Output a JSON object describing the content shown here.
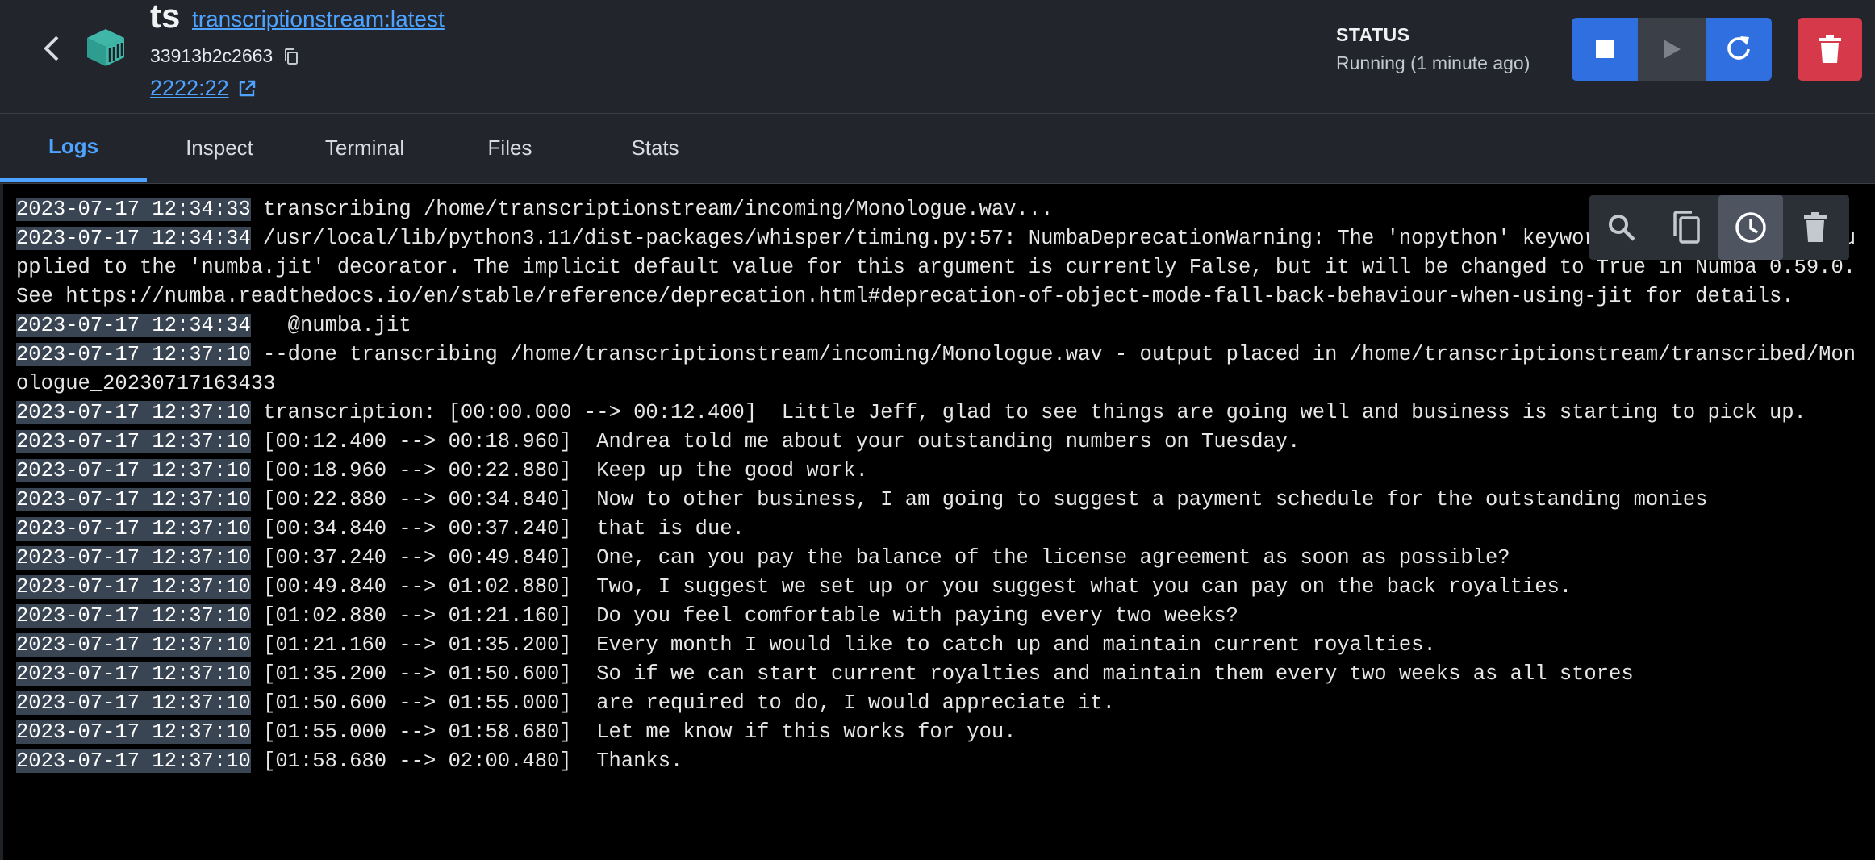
{
  "header": {
    "container_name": "ts",
    "image_link": "transcriptionstream:latest",
    "container_id": "33913b2c2663",
    "port_link": "2222:22",
    "status_label": "STATUS",
    "status_value": "Running (1 minute ago)"
  },
  "tabs": [
    {
      "label": "Logs",
      "active": true
    },
    {
      "label": "Inspect"
    },
    {
      "label": "Terminal"
    },
    {
      "label": "Files"
    },
    {
      "label": "Stats"
    }
  ],
  "colors": {
    "accent": "#4da3ff",
    "primary_button": "#2f6fe0",
    "delete_button": "#d63a4a",
    "timestamp_bg": "#3a4553"
  },
  "log_lines": [
    {
      "ts": "2023-07-17 12:34:33",
      "text": " transcribing /home/transcriptionstream/incoming/Monologue.wav..."
    },
    {
      "ts": "2023-07-17 12:34:34",
      "text": " /usr/local/lib/python3.11/dist-packages/whisper/timing.py:57: NumbaDeprecationWarning: The 'nopython' keyword argument was not supplied to the 'numba.jit' decorator. The implicit default value for this argument is currently False, but it will be changed to True in Numba 0.59.0. See https://numba.readthedocs.io/en/stable/reference/deprecation.html#deprecation-of-object-mode-fall-back-behaviour-when-using-jit for details."
    },
    {
      "ts": "2023-07-17 12:34:34",
      "text": "   @numba.jit"
    },
    {
      "ts": "2023-07-17 12:37:10",
      "text": " --done transcribing /home/transcriptionstream/incoming/Monologue.wav - output placed in /home/transcriptionstream/transcribed/Monologue_20230717163433"
    },
    {
      "ts": "2023-07-17 12:37:10",
      "text": " transcription: [00:00.000 --> 00:12.400]  Little Jeff, glad to see things are going well and business is starting to pick up."
    },
    {
      "ts": "2023-07-17 12:37:10",
      "text": " [00:12.400 --> 00:18.960]  Andrea told me about your outstanding numbers on Tuesday."
    },
    {
      "ts": "2023-07-17 12:37:10",
      "text": " [00:18.960 --> 00:22.880]  Keep up the good work."
    },
    {
      "ts": "2023-07-17 12:37:10",
      "text": " [00:22.880 --> 00:34.840]  Now to other business, I am going to suggest a payment schedule for the outstanding monies"
    },
    {
      "ts": "2023-07-17 12:37:10",
      "text": " [00:34.840 --> 00:37.240]  that is due."
    },
    {
      "ts": "2023-07-17 12:37:10",
      "text": " [00:37.240 --> 00:49.840]  One, can you pay the balance of the license agreement as soon as possible?"
    },
    {
      "ts": "2023-07-17 12:37:10",
      "text": " [00:49.840 --> 01:02.880]  Two, I suggest we set up or you suggest what you can pay on the back royalties."
    },
    {
      "ts": "2023-07-17 12:37:10",
      "text": " [01:02.880 --> 01:21.160]  Do you feel comfortable with paying every two weeks?"
    },
    {
      "ts": "2023-07-17 12:37:10",
      "text": " [01:21.160 --> 01:35.200]  Every month I would like to catch up and maintain current royalties."
    },
    {
      "ts": "2023-07-17 12:37:10",
      "text": " [01:35.200 --> 01:50.600]  So if we can start current royalties and maintain them every two weeks as all stores"
    },
    {
      "ts": "2023-07-17 12:37:10",
      "text": " [01:50.600 --> 01:55.000]  are required to do, I would appreciate it."
    },
    {
      "ts": "2023-07-17 12:37:10",
      "text": " [01:55.000 --> 01:58.680]  Let me know if this works for you."
    },
    {
      "ts": "2023-07-17 12:37:10",
      "text": " [01:58.680 --> 02:00.480]  Thanks."
    }
  ]
}
